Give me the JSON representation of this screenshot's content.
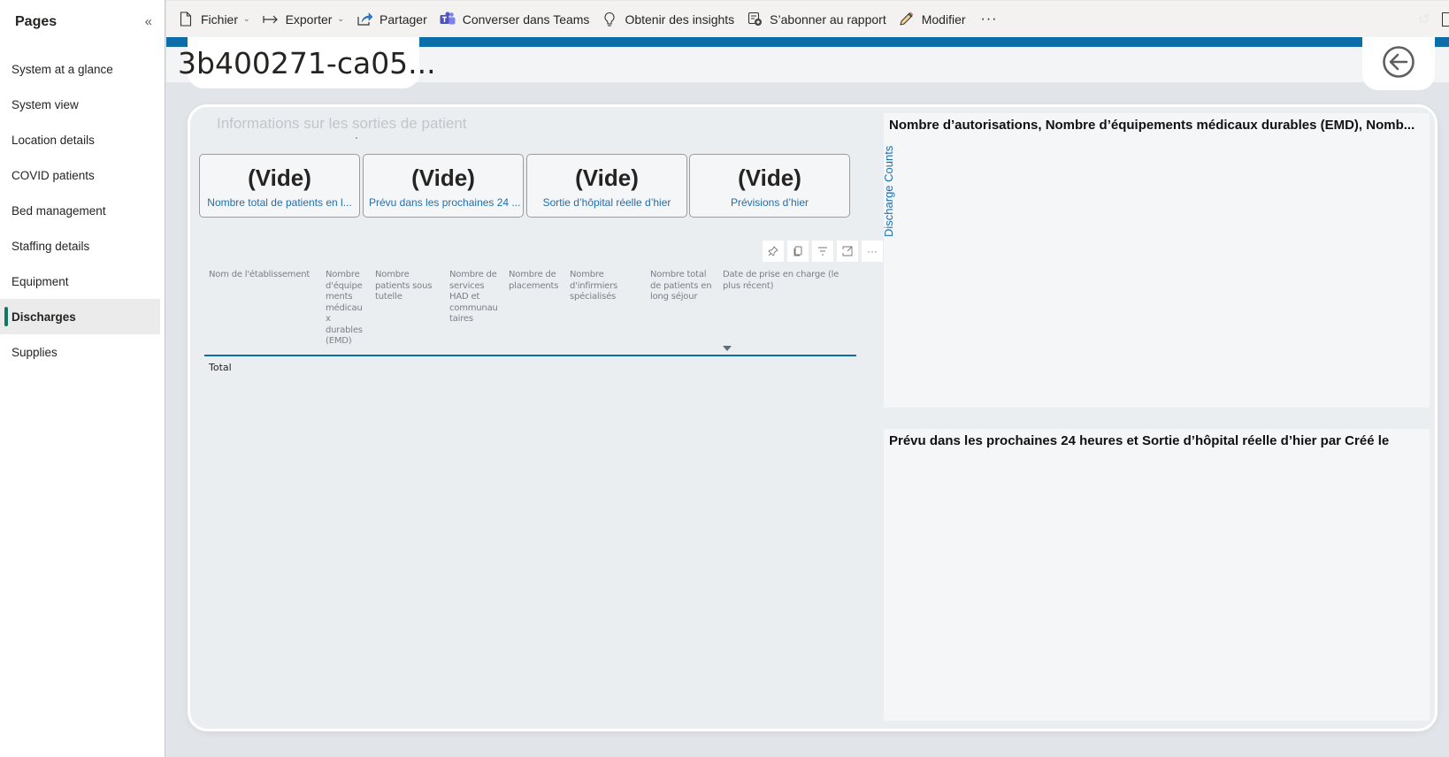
{
  "sidebar": {
    "title": "Pages",
    "collapse_icon": "double-chevron-left-icon",
    "items": [
      {
        "label": "System at a glance",
        "active": false
      },
      {
        "label": "System view",
        "active": false
      },
      {
        "label": "Location details",
        "active": false
      },
      {
        "label": "COVID patients",
        "active": false
      },
      {
        "label": "Bed management",
        "active": false
      },
      {
        "label": "Staffing details",
        "active": false
      },
      {
        "label": "Equipment",
        "active": false
      },
      {
        "label": "Discharges",
        "active": true
      },
      {
        "label": "Supplies",
        "active": false
      }
    ]
  },
  "toolbar": {
    "file": "Fichier",
    "export": "Exporter",
    "share": "Partager",
    "teams": "Converser dans Teams",
    "insights": "Obtenir des insights",
    "subscribe": "S’abonner au rapport",
    "edit": "Modifier",
    "more": "···"
  },
  "report": {
    "title": "3b400271-ca05...",
    "accent_color": "#0b6ea8",
    "section_title": "Informations sur les sorties de patient"
  },
  "kpis": [
    {
      "value": "(Vide)",
      "label": "Nombre total de patients en l..."
    },
    {
      "value": "(Vide)",
      "label": "Prévu dans les prochaines 24 ..."
    },
    {
      "value": "(Vide)",
      "label": "Sortie d’hôpital réelle d’hier"
    },
    {
      "value": "(Vide)",
      "label": "Prévisions d’hier"
    }
  ],
  "table": {
    "columns": [
      "Nom de l'établissement",
      "Nombre d'équipe ments médicau x durables (EMD)",
      "Nombre patients sous tutelle",
      "Nombre de services HAD et communau taires",
      "Nombre de placements",
      "Nombre d'infirmiers spécialisés",
      "Nombre total de patients en long séjour",
      "Date de prise en charge (le plus récent)"
    ],
    "column_lines": [
      [
        "Nom de l'établissement"
      ],
      [
        "Nombre",
        "d'équipe",
        "ments",
        "médicau",
        "x",
        "durables",
        "(EMD)"
      ],
      [
        "Nombre",
        "patients sous",
        "tutelle"
      ],
      [
        "Nombre de",
        "services",
        "HAD et",
        "communau",
        "taires"
      ],
      [
        "Nombre de",
        "placements"
      ],
      [
        "Nombre",
        "d'infirmiers",
        "spécialisés"
      ],
      [
        "Nombre total",
        "de patients en",
        "long séjour"
      ],
      [
        "Date de prise en charge (le",
        "plus récent)"
      ]
    ],
    "total_label": "Total"
  },
  "charts": [
    {
      "title": "Nombre d’autorisations, Nombre d’équipements médicaux durables (EMD), Nomb...",
      "ylabel": "Discharge Counts"
    },
    {
      "title": "Prévu dans les prochaines 24 heures et Sortie d’hôpital réelle d’hier par Créé le"
    }
  ]
}
